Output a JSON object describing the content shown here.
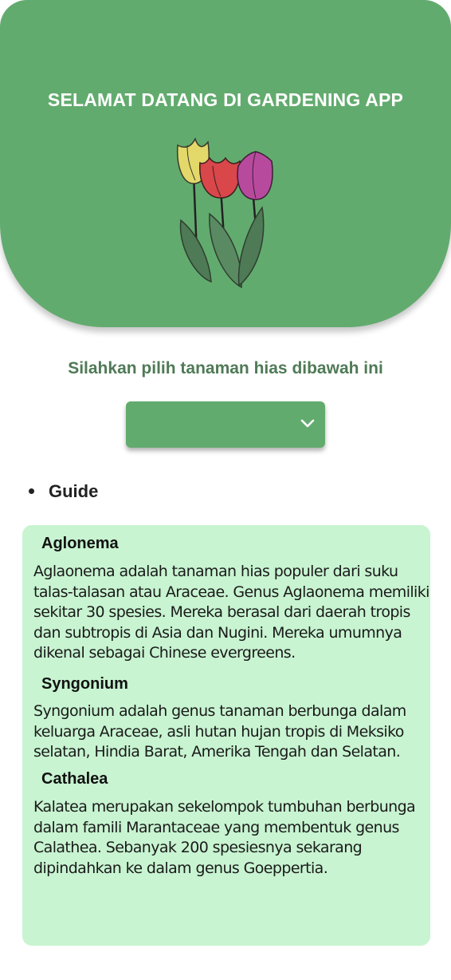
{
  "header": {
    "title": "SELAMAT DATANG DI GARDENING APP",
    "illustration": "tulips-icon"
  },
  "subtitle": "Silahkan pilih tanaman hias dibawah ini",
  "dropdown": {
    "selected": "",
    "icon": "chevron-down-icon"
  },
  "guide": {
    "label": "Guide"
  },
  "plants": [
    {
      "name": "Aglonema",
      "description": "Aglaonema adalah tanaman hias populer dari suku talas-talasan atau Araceae. Genus Aglaonema memiliki sekitar 30 spesies. Mereka berasal dari daerah tropis dan subtropis di Asia dan Nugini. Mereka umumnya dikenal sebagai Chinese evergreens."
    },
    {
      "name": "Syngonium",
      "description": "Syngonium adalah genus tanaman berbunga dalam keluarga Araceae, asli hutan hujan tropis di Meksiko selatan, Hindia Barat, Amerika Tengah dan Selatan."
    },
    {
      "name": "Cathalea",
      "description": "Kalatea merupakan sekelompok tumbuhan berbunga dalam famili Marantaceae yang membentuk genus Calathea. Sebanyak 200 spesiesnya sekarang dipindahkan ke dalam genus Goeppertia."
    }
  ],
  "colors": {
    "primary": "#62ab6e",
    "card_background": "#c8f4d1",
    "subtitle": "#4f7a56"
  }
}
